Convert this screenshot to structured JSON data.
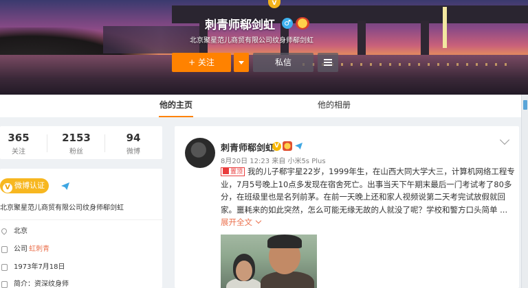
{
  "profile": {
    "name": "刺青师郗剑虹",
    "subtitle": "北京聚星范儿商贸有限公司纹身师郗剑虹",
    "verified_mark": "V",
    "gender_mark": "♂"
  },
  "actions": {
    "follow_label": "+ 关注",
    "message_label": "私信"
  },
  "tabs": [
    {
      "label": "他的主页",
      "active": true
    },
    {
      "label": "他的相册",
      "active": false
    }
  ],
  "stats": [
    {
      "value": "365",
      "label": "关注"
    },
    {
      "value": "2153",
      "label": "粉丝"
    },
    {
      "value": "94",
      "label": "微博"
    }
  ],
  "info": {
    "cert_badge": "微博认证",
    "cert_badge_mark": "V",
    "cert_text": "北京聚星范儿商贸有限公司纹身师郗剑虹",
    "city": "北京",
    "company_prefix": "公司",
    "company_link": "虹刺青",
    "birthday": "1973年7月18日",
    "intro": "简介：资深纹身师"
  },
  "post": {
    "author": "刺青师郗剑虹",
    "vip_mark": "V",
    "meta": "8月20日 12:23 来自 小米5s Plus",
    "pin_label": "置顶",
    "text": "我的儿子郗宇星22岁，1999年生，在山西大同大学大三，计算机网络工程专业，7月5号晚上10点多发现在宿舍死亡。出事当天下午期末最后一门考试考了80多分，在班级里也是名列前茅。在前一天晚上还和家人视频说第二天考完试放假就回家。噩耗来的如此突然，怎么可能无缘无故的人就没了呢？学校和警方口头简单 ...",
    "expand_label": "展开全文"
  },
  "icons": {
    "location": "location-pin-icon",
    "company": "briefcase-icon",
    "birthday": "cake-icon",
    "intro": "info-icon",
    "send": "paper-plane-icon",
    "more": "menu-icon"
  },
  "colors": {
    "accent": "#ff8200",
    "link": "#eb7350",
    "cert_yellow": "#f7b720",
    "blue": "#3ea6e2"
  }
}
